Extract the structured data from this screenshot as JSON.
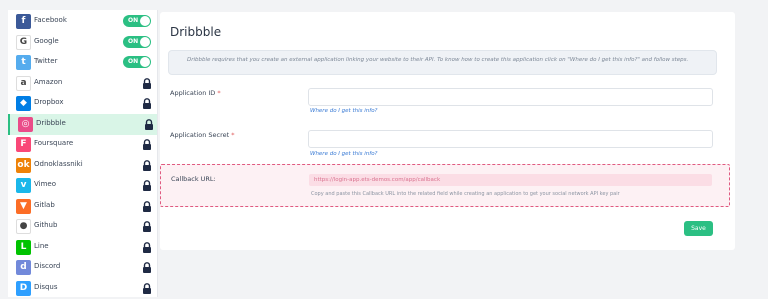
{
  "sidebar": {
    "items": [
      {
        "label": "Facebook",
        "icon": "facebook-icon",
        "color": "#3b5998",
        "glyph": "f",
        "toggle": "ON"
      },
      {
        "label": "Google",
        "icon": "google-icon",
        "color": "#ffffff",
        "glyph": "G",
        "toggle": "ON"
      },
      {
        "label": "Twitter",
        "icon": "twitter-icon",
        "color": "#55acee",
        "glyph": "t",
        "toggle": "ON"
      },
      {
        "label": "Amazon",
        "icon": "amazon-icon",
        "color": "#ffffff",
        "glyph": "a"
      },
      {
        "label": "Dropbox",
        "icon": "dropbox-icon",
        "color": "#007ee5",
        "glyph": "◆"
      },
      {
        "label": "Dribbble",
        "icon": "dribbble-icon",
        "color": "#ea4c89",
        "glyph": "◎"
      },
      {
        "label": "Foursquare",
        "icon": "foursquare-icon",
        "color": "#f94877",
        "glyph": "F"
      },
      {
        "label": "Odnoklassniki",
        "icon": "odnoklassniki-icon",
        "color": "#ee8208",
        "glyph": "ok"
      },
      {
        "label": "Vimeo",
        "icon": "vimeo-icon",
        "color": "#1ab7ea",
        "glyph": "v"
      },
      {
        "label": "Gitlab",
        "icon": "gitlab-icon",
        "color": "#fc6d26",
        "glyph": "▼"
      },
      {
        "label": "Github",
        "icon": "github-icon",
        "color": "#ffffff",
        "glyph": "●"
      },
      {
        "label": "Line",
        "icon": "line-icon",
        "color": "#00c300",
        "glyph": "L"
      },
      {
        "label": "Discord",
        "icon": "discord-icon",
        "color": "#7289da",
        "glyph": "d"
      },
      {
        "label": "Disqus",
        "icon": "disqus-icon",
        "color": "#2e9fff",
        "glyph": "D"
      }
    ]
  },
  "main": {
    "title": "Dribbble",
    "info": "Dribbble requires that you create an external application linking your website to their API. To know how to create this application click on \"Where do I get this info?\" and follow steps.",
    "app_id_label": "Application ID",
    "app_secret_label": "Application Secret",
    "required_mark": "*",
    "help_link": "Where do I get this info?",
    "callback_label": "Callback URL:",
    "callback_url": "https://login-app.ets-demos.com/app/callback",
    "callback_help": "Copy and paste this Callback URL into the related field while creating an application to get your social network API key pair",
    "save_label": "Save"
  },
  "colors": {
    "accent": "#2bbf83",
    "active_bg": "#d9f5e7",
    "callback_border": "#e05a80"
  }
}
